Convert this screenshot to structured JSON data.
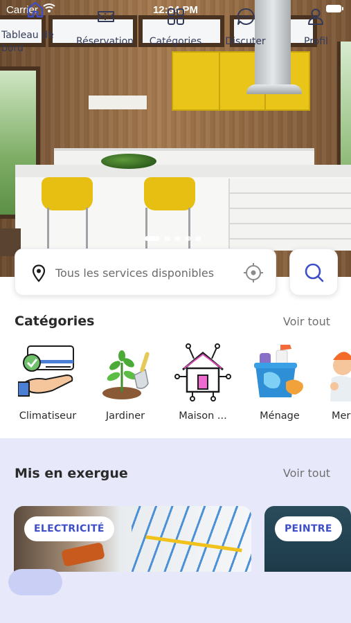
{
  "status_bar": {
    "carrier": "Carrier",
    "time": "12:34 PM"
  },
  "hero": {
    "image": "kitchen-interior",
    "slides": 5,
    "active_slide": 1
  },
  "search": {
    "placeholder": "Tous les services disponibles"
  },
  "categories": {
    "title": "Catégories",
    "see_all": "Voir tout",
    "items": [
      {
        "label": "Climatiseur",
        "icon": "air-conditioner-icon"
      },
      {
        "label": "Jardiner",
        "icon": "gardening-icon"
      },
      {
        "label": "Maison ...",
        "icon": "smart-home-icon"
      },
      {
        "label": "Ménage",
        "icon": "cleaning-icon"
      },
      {
        "label": "Mer",
        "icon": "handyman-icon"
      }
    ]
  },
  "featured": {
    "title": "Mis en exergue",
    "see_all": "Voir tout",
    "cards": [
      {
        "tag": "ELECTRICITÉ"
      },
      {
        "tag": "PEINTRE"
      }
    ]
  },
  "nav": {
    "items": [
      {
        "label": "Tableau de bord",
        "icon": "home-icon",
        "active": true
      },
      {
        "label": "Réservation",
        "icon": "ticket-icon",
        "active": false
      },
      {
        "label": "Catégories",
        "icon": "grid-icon",
        "active": false
      },
      {
        "label": "Discuter",
        "icon": "chat-icon",
        "active": false
      },
      {
        "label": "Profil",
        "icon": "user-icon",
        "active": false
      }
    ]
  },
  "colors": {
    "accent": "#3d4ec7",
    "nav_background": "#e7e9fb",
    "active_pill": "#c9cff5"
  }
}
